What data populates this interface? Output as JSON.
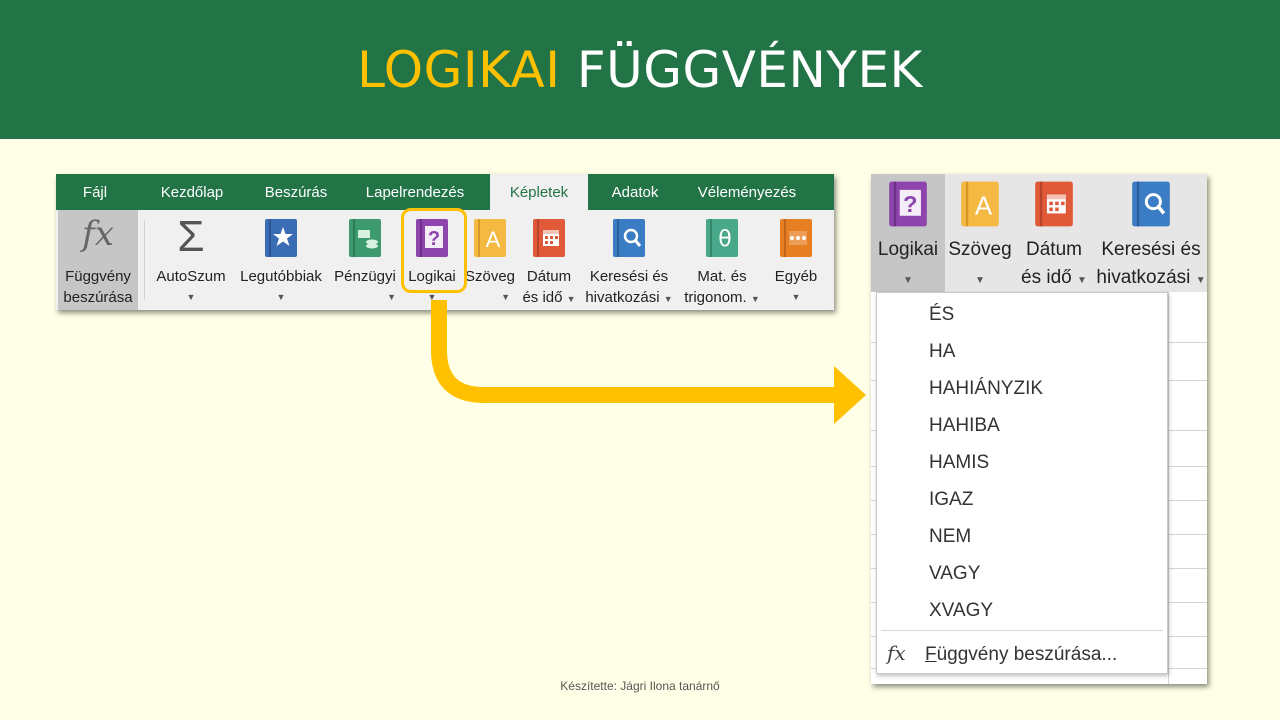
{
  "slide": {
    "title_highlight": "LOGIKAI",
    "title_rest": "FÜGGVÉNYEK",
    "credit": "Készítette: Jágri Ilona tanárnő"
  },
  "ribbon": {
    "tabs": [
      "Fájl",
      "Kezdőlap",
      "Beszúrás",
      "Lapelrendezés",
      "Képletek",
      "Adatok",
      "Véleményezés"
    ],
    "active_tab": "Képletek",
    "buttons": {
      "insert_function": [
        "Függvény",
        "beszúrása"
      ],
      "autosum": "AutoSzum",
      "recent": "Legutóbbiak",
      "financial": "Pénzügyi",
      "logical": "Logikai",
      "text": "Szöveg",
      "date_time": [
        "Dátum",
        "és idő"
      ],
      "lookup": [
        "Keresési és",
        "hivatkozási"
      ],
      "math": [
        "Mat. és",
        "trigonom."
      ],
      "more": "Egyéb"
    }
  },
  "dropdown_panel": {
    "buttons": {
      "logical": "Logikai",
      "text": "Szöveg",
      "date_time": [
        "Dátum",
        "és idő"
      ],
      "lookup": [
        "Keresési és",
        "hivatkozási"
      ]
    },
    "items": [
      "ÉS",
      "HA",
      "HAHIÁNYZIK",
      "HAHIBA",
      "HAMIS",
      "IGAZ",
      "NEM",
      "VAGY",
      "XVAGY"
    ],
    "footer_underlined": "F",
    "footer_rest": "üggvény beszúrása..."
  },
  "colors": {
    "banner": "#227446",
    "title_highlight": "#FFC000",
    "arrow": "#FFC000",
    "logical_icon": "#8E44AD",
    "text_icon": "#F4B942",
    "date_icon": "#E05A3A",
    "lookup_icon": "#3B7DC4",
    "financial_icon": "#3C9A6E",
    "recent_icon": "#3B6DB4",
    "math_icon": "#4AA88A",
    "more_icon": "#E67E22"
  },
  "icons": [
    "function-icon",
    "sum-icon",
    "star-book-icon",
    "money-book-icon",
    "question-book-icon",
    "text-book-icon",
    "calendar-book-icon",
    "search-book-icon",
    "theta-book-icon",
    "ellipsis-book-icon",
    "arrow-icon"
  ]
}
